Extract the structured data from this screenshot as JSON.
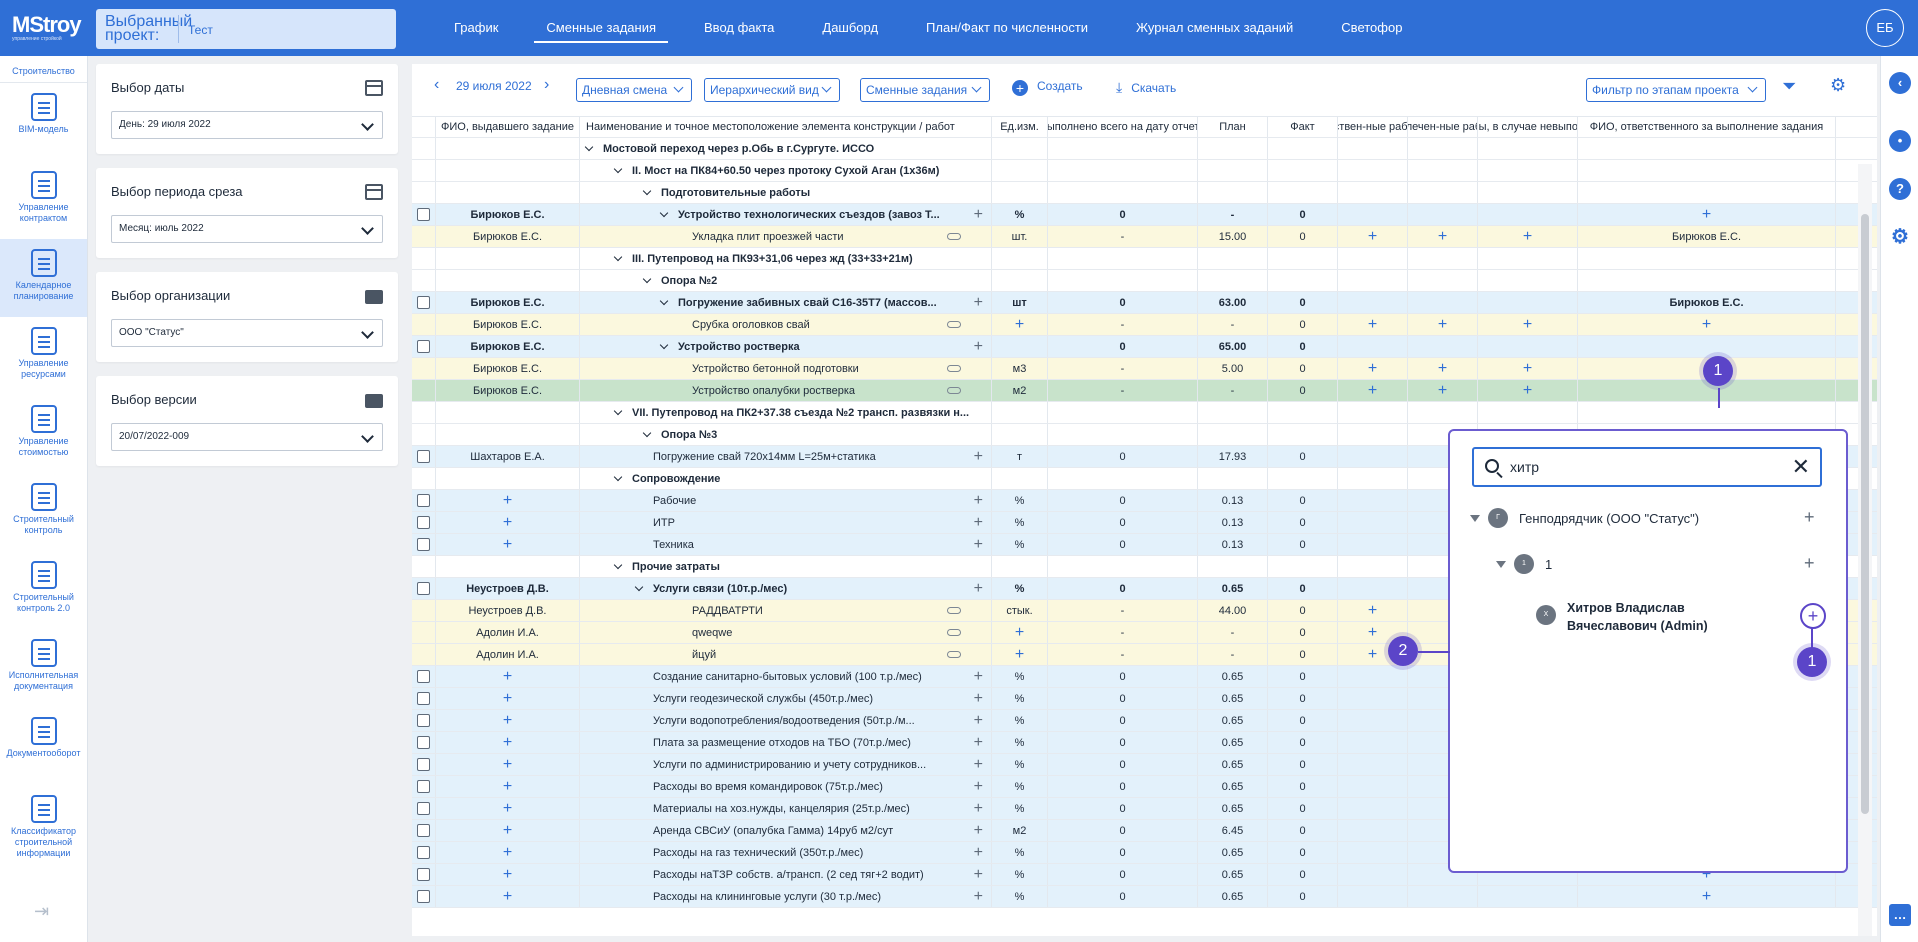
{
  "topbar": {
    "logo": "MStroy",
    "logo_sub": "управление стройкой",
    "project_label": "Выбранный проект:",
    "project_value": "Тест",
    "nav": [
      "График",
      "Сменные задания",
      "Ввод факта",
      "Дашборд",
      "План/Факт по численности",
      "Журнал сменных заданий",
      "Светофор"
    ],
    "avatar": "ЕБ"
  },
  "sidebar": {
    "top": "Строительство",
    "items": [
      "BIM-модель",
      "Управление контрактом",
      "Календарное планирование",
      "Управление ресурсами",
      "Управление стоимостью",
      "Строительный контроль",
      "Строительный контроль 2.0",
      "Исполнительная документация",
      "Документооборот",
      "Классификатор строительной информации"
    ]
  },
  "filters": [
    {
      "title": "Выбор даты",
      "value": "День: 29 июля 2022",
      "icon": "calendar-icon"
    },
    {
      "title": "Выбор периода среза",
      "value": "Месяц: июль 2022",
      "icon": "calendar-icon"
    },
    {
      "title": "Выбор организации",
      "value": "ООО \"Статус\"",
      "icon": "folder-icon"
    },
    {
      "title": "Выбор версии",
      "value": "20/07/2022-009",
      "icon": "folder-icon"
    }
  ],
  "toolbar": {
    "date": "29 июля 2022",
    "shift": "Дневная смена",
    "view": "Иерархический вид",
    "type": "Сменные задания",
    "create": "Создать",
    "download": "Скачать",
    "stage_filter": "Фильтр по этапам проекта"
  },
  "columns": [
    "",
    "ФИО, выдавшего задание",
    "Наименование и точное местоположение элемента конструкции / работ",
    "Ед.изм.",
    "Выполнено всего на дату отчета",
    "План",
    "Факт",
    "Собствен-ные рабочие",
    "Привлечен-ные рабочие",
    "Причины, в случае невыполнения",
    "ФИО, ответственного за выполнение задания"
  ],
  "rows": [
    {
      "k": "g",
      "lvl": 0,
      "name": "Мостовой переход через р.Обь в г.Сургуте. ИССО"
    },
    {
      "k": "g",
      "lvl": 1,
      "name": "II. Мост на ПК84+60.50 через протоку Сухой Аган (1х36м)"
    },
    {
      "k": "g",
      "lvl": 2,
      "name": "Подготовительные работы"
    },
    {
      "k": "t",
      "c": "blue",
      "chk": true,
      "iss": "Бирюков Е.С.",
      "lvl": 3,
      "name": "Устройство технологических съездов (завоз Т...",
      "unit": "%",
      "done": "0",
      "plan": "-",
      "fact": "0",
      "resp": "+"
    },
    {
      "k": "s",
      "c": "yellow",
      "iss": "Бирюков Е.С.",
      "name": "Укладка плит проезжей части",
      "unit": "шт.",
      "done": "-",
      "plan": "15.00",
      "fact": "0",
      "own": "+",
      "att": "+",
      "why": "+",
      "resp": "Бирюков Е.С."
    },
    {
      "k": "g",
      "lvl": 1,
      "name": "III. Путепровод на ПК93+31,06 через жд (33+33+21м)"
    },
    {
      "k": "g",
      "lvl": 2,
      "name": "Опора №2"
    },
    {
      "k": "t",
      "c": "blue",
      "chk": true,
      "iss": "Бирюков Е.С.",
      "lvl": 3,
      "name": "Погружение забивных свай С16-35Т7 (массов...",
      "unit": "шт",
      "done": "0",
      "plan": "63.00",
      "fact": "0",
      "resp": "Бирюков Е.С."
    },
    {
      "k": "s",
      "c": "yellow",
      "iss": "Бирюков Е.С.",
      "name": "Срубка оголовков свай",
      "unit": "+",
      "done": "-",
      "plan": "-",
      "fact": "0",
      "own": "+",
      "att": "+",
      "why": "+",
      "resp": "+"
    },
    {
      "k": "t",
      "c": "blue",
      "chk": true,
      "iss": "Бирюков Е.С.",
      "lvl": 3,
      "name": "Устройство ростверка",
      "unit": "",
      "done": "0",
      "plan": "65.00",
      "fact": "0",
      "resp": ""
    },
    {
      "k": "s",
      "c": "yellow",
      "iss": "Бирюков Е.С.",
      "name": "Устройство бетонной подготовки",
      "unit": "м3",
      "done": "-",
      "plan": "5.00",
      "fact": "0",
      "own": "+",
      "att": "+",
      "why": "+",
      "resp": ""
    },
    {
      "k": "s",
      "c": "green",
      "iss": "Бирюков Е.С.",
      "name": "Устройство опалубки ростверка",
      "unit": "м2",
      "done": "-",
      "plan": "-",
      "fact": "0",
      "own": "+",
      "att": "+",
      "why": "+",
      "resp": ""
    },
    {
      "k": "g",
      "lvl": 1,
      "name": "VII. Путепровод на ПК2+37.38 съезда №2 трансп. развязки н..."
    },
    {
      "k": "g",
      "lvl": 2,
      "name": "Опора №3"
    },
    {
      "k": "r",
      "c": "blue",
      "chk": true,
      "iss": "Шахтаров Е.А.",
      "name": "Погружение свай 720х14мм L=25м+статика",
      "unit": "т",
      "done": "0",
      "plan": "17.93",
      "fact": "0"
    },
    {
      "k": "g",
      "lvl": 1,
      "name": "Сопровождение"
    },
    {
      "k": "r",
      "c": "blue",
      "chk": true,
      "iss": "+",
      "name": "Рабочие",
      "unit": "%",
      "done": "0",
      "plan": "0.13",
      "fact": "0"
    },
    {
      "k": "r",
      "c": "blue",
      "chk": true,
      "iss": "+",
      "name": "ИТР",
      "unit": "%",
      "done": "0",
      "plan": "0.13",
      "fact": "0"
    },
    {
      "k": "r",
      "c": "blue",
      "chk": true,
      "iss": "+",
      "name": "Техника",
      "unit": "%",
      "done": "0",
      "plan": "0.13",
      "fact": "0"
    },
    {
      "k": "g",
      "lvl": 1,
      "name": "Прочие затраты"
    },
    {
      "k": "t",
      "c": "blue",
      "chk": true,
      "iss": "Неустроев Д.В.",
      "lvl": 2,
      "name": "Услуги связи (10т.р./мес)",
      "unit": "%",
      "done": "0",
      "plan": "0.65",
      "fact": "0"
    },
    {
      "k": "s",
      "c": "yellow",
      "iss": "Неустроев Д.В.",
      "name": "РАДДВАТРТИ",
      "unit": "стык.",
      "done": "-",
      "plan": "44.00",
      "fact": "0",
      "own": "+"
    },
    {
      "k": "s",
      "c": "yellow",
      "iss": "Адолин И.А.",
      "name": "qweqwe",
      "unit": "+",
      "done": "-",
      "plan": "-",
      "fact": "0",
      "own": "+"
    },
    {
      "k": "s",
      "c": "yellow",
      "iss": "Адолин И.А.",
      "name": "йцуй",
      "unit": "+",
      "done": "-",
      "plan": "-",
      "fact": "0",
      "own": "+"
    },
    {
      "k": "r",
      "c": "blue",
      "chk": true,
      "iss": "+",
      "name": "Создание санитарно-бытовых условий (100 т.р./мес)",
      "unit": "%",
      "done": "0",
      "plan": "0.65",
      "fact": "0"
    },
    {
      "k": "r",
      "c": "blue",
      "chk": true,
      "iss": "+",
      "name": "Услуги геодезической службы (450т.р./мес)",
      "unit": "%",
      "done": "0",
      "plan": "0.65",
      "fact": "0"
    },
    {
      "k": "r",
      "c": "blue",
      "chk": true,
      "iss": "+",
      "name": "Услуги водопотребления/водоотведения (50т.р./м...",
      "unit": "%",
      "done": "0",
      "plan": "0.65",
      "fact": "0"
    },
    {
      "k": "r",
      "c": "blue",
      "chk": true,
      "iss": "+",
      "name": "Плата за размещение отходов на ТБО (70т.р./мес)",
      "unit": "%",
      "done": "0",
      "plan": "0.65",
      "fact": "0"
    },
    {
      "k": "r",
      "c": "blue",
      "chk": true,
      "iss": "+",
      "name": "Услуги по администрированию и учету сотрудников...",
      "unit": "%",
      "done": "0",
      "plan": "0.65",
      "fact": "0"
    },
    {
      "k": "r",
      "c": "blue",
      "chk": true,
      "iss": "+",
      "name": "Расходы во время командировок (75т.р./мес)",
      "unit": "%",
      "done": "0",
      "plan": "0.65",
      "fact": "0"
    },
    {
      "k": "r",
      "c": "blue",
      "chk": true,
      "iss": "+",
      "name": "Материалы на хоз.нужды, канцелярия (25т.р./мес)",
      "unit": "%",
      "done": "0",
      "plan": "0.65",
      "fact": "0"
    },
    {
      "k": "r",
      "c": "blue",
      "chk": true,
      "iss": "+",
      "name": "Аренда СВСиУ (опалубка Гамма) 14руб м2/сут",
      "unit": "м2",
      "done": "0",
      "plan": "6.45",
      "fact": "0"
    },
    {
      "k": "r",
      "c": "blue",
      "chk": true,
      "iss": "+",
      "name": "Расходы на газ технический (350т.р./мес)",
      "unit": "%",
      "done": "0",
      "plan": "0.65",
      "fact": "0",
      "resp": "+"
    },
    {
      "k": "r",
      "c": "blue",
      "chk": true,
      "iss": "+",
      "name": "Расходы наТЗР собств. а/трансп. (2 сед тяг+2 водит)",
      "unit": "%",
      "done": "0",
      "plan": "0.65",
      "fact": "0",
      "resp": "+"
    },
    {
      "k": "r",
      "c": "blue",
      "chk": true,
      "iss": "+",
      "name": "Расходы на клининговые услуги (30 т.р./мес)",
      "unit": "%",
      "done": "0",
      "plan": "0.65",
      "fact": "0",
      "resp": "+"
    }
  ],
  "popup": {
    "search_value": "хитр",
    "nodes": [
      {
        "badge": "Г",
        "label": "Генподрядчик (ООО \"Статус\")"
      },
      {
        "badge": "1",
        "label": "1"
      },
      {
        "badge": "Х",
        "label": "Хитров Владислав Вячеславович (Admin)"
      }
    ]
  },
  "markers": [
    "1",
    "1",
    "2"
  ]
}
